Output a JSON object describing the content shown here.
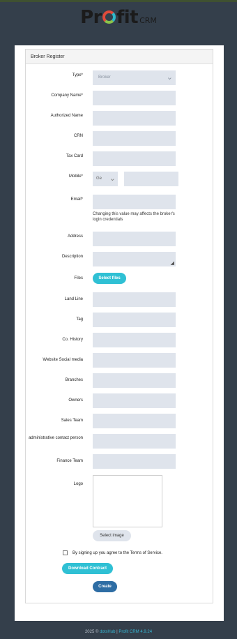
{
  "brand": {
    "name_left": "Pr",
    "name_right": "fit",
    "suffix": "CRM"
  },
  "panel": {
    "title": "Broker Register"
  },
  "form": {
    "type": {
      "label": "Type*",
      "value": "Broker"
    },
    "company_name": {
      "label": "Company Name*"
    },
    "authorized_name": {
      "label": "Authorized Name"
    },
    "crn": {
      "label": "CRN"
    },
    "tax_card": {
      "label": "Tax Card"
    },
    "mobile": {
      "label": "Mobile*",
      "country_code": "Ge"
    },
    "email": {
      "label": "Email*",
      "note": "Changing this value may affects the broker's login credentials"
    },
    "address": {
      "label": "Address"
    },
    "description": {
      "label": "Description"
    },
    "files": {
      "label": "Files",
      "button": "Select files"
    },
    "land_line": {
      "label": "Land Line"
    },
    "tag": {
      "label": "Tag"
    },
    "co_history": {
      "label": "Co. History"
    },
    "website": {
      "label": "Website Social media"
    },
    "branches": {
      "label": "Branches"
    },
    "owners": {
      "label": "Owners"
    },
    "sales_team": {
      "label": "Sales Team"
    },
    "admin_contact": {
      "label": "administrative contact person"
    },
    "finance_team": {
      "label": "Finance Team"
    },
    "logo": {
      "label": "Logo",
      "button": "Select image"
    },
    "terms": {
      "text": "By signing up you agree to the Terms of Service."
    },
    "download_contract": "Download Contract",
    "create": "Create"
  },
  "footer": {
    "year": "2025 ©",
    "company": "dotsHub",
    "sep": "|",
    "product": "Profit CRM 4.9.24"
  },
  "colors": {
    "accent": "#2fc0d4",
    "primary": "#2e6da4",
    "field": "#dfe4ec",
    "background": "#343f4b"
  }
}
